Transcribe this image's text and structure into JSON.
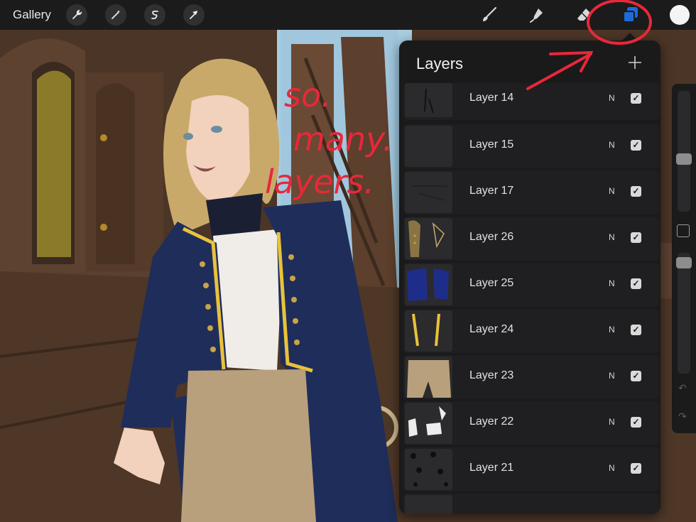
{
  "toolbar": {
    "gallery_label": "Gallery",
    "left_tools": [
      "wrench-icon",
      "magic-wand-icon",
      "selection-icon",
      "transform-arrow-icon"
    ],
    "right_tools": [
      "brush-icon",
      "smudge-icon",
      "eraser-icon",
      "layers-icon"
    ],
    "active_tool": "layers-icon",
    "current_color": "#f4f4f4",
    "layers_accent": "#1e6bd6"
  },
  "layers_panel": {
    "title": "Layers",
    "add_icon": "plus-icon",
    "layers": [
      {
        "name": "Layer 14",
        "blend": "N",
        "visible": true
      },
      {
        "name": "Layer 15",
        "blend": "N",
        "visible": true
      },
      {
        "name": "Layer 17",
        "blend": "N",
        "visible": true
      },
      {
        "name": "Layer 26",
        "blend": "N",
        "visible": true
      },
      {
        "name": "Layer 25",
        "blend": "N",
        "visible": true
      },
      {
        "name": "Layer 24",
        "blend": "N",
        "visible": true
      },
      {
        "name": "Layer 23",
        "blend": "N",
        "visible": true
      },
      {
        "name": "Layer 22",
        "blend": "N",
        "visible": true
      },
      {
        "name": "Layer 21",
        "blend": "N",
        "visible": true
      }
    ]
  },
  "sidebar": {
    "size_slider_icon": "brush-size-slider",
    "opacity_slider_icon": "opacity-slider",
    "modify_icon": "modify-square-icon",
    "undo_icon": "undo-icon",
    "redo_icon": "redo-icon"
  },
  "annotation": {
    "text_lines": [
      "so.",
      "many.",
      "layers."
    ],
    "color": "#e8283a"
  }
}
